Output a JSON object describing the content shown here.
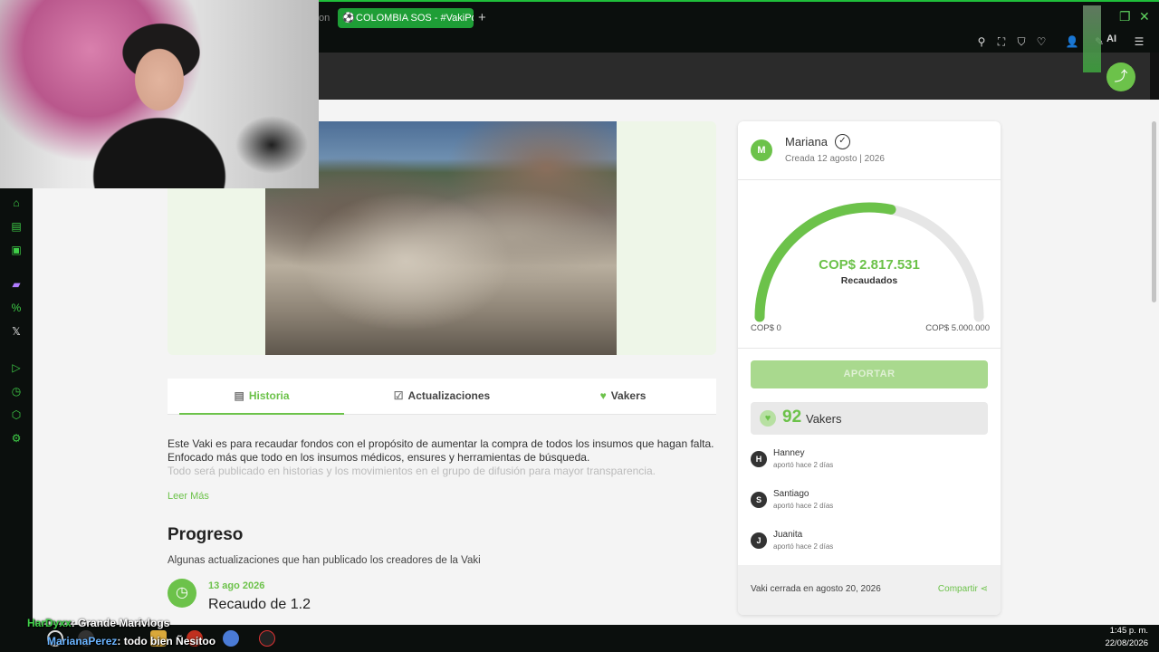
{
  "browser": {
    "prev_tab_fragment": "on",
    "active_tab_title": "COLOMBIA SOS - #VakiPor",
    "new_tab_symbol": "+",
    "ai_label": "AI"
  },
  "campaign": {
    "tabs": [
      {
        "label": "Historia"
      },
      {
        "label": "Actualizaciones"
      },
      {
        "label": "Vakers"
      }
    ],
    "story": [
      "Este Vaki es para recaudar fondos con el propósito de aumentar la compra de todos los insumos que hagan falta.",
      "Enfocado más que todo en los insumos médicos, ensures y herramientas de búsqueda.",
      "Todo será publicado en historias y los movimientos en el grupo de difusión para mayor transparencia."
    ],
    "read_more": "Leer Más",
    "progress_title": "Progreso",
    "progress_subtitle": "Algunas actualizaciones que han publicado los creadores de la Vaki",
    "update": {
      "date": "13 ago 2026",
      "title": "Recaudo de 1.2"
    }
  },
  "card": {
    "creator_initial": "M",
    "creator_name": "Mariana",
    "created_date": "Creada 12 agosto | 2026",
    "raised_amount": "COP$ 2.817.531",
    "raised_label": "Recaudados",
    "min_label": "COP$ 0",
    "max_label": "COP$ 5.000.000",
    "progress_fraction": 0.5635,
    "aportar_label": "APORTAR",
    "vakers_count": "92",
    "vakers_word": "Vakers",
    "donors": [
      {
        "initial": "H",
        "name": "Hanney",
        "time": "aportó hace 2 días"
      },
      {
        "initial": "S",
        "name": "Santiago",
        "time": "aportó hace 2 días"
      },
      {
        "initial": "J",
        "name": "Juanita",
        "time": "aportó hace 2 días"
      }
    ],
    "closed_text": "Vaki cerrada en agosto 20, 2026",
    "share_label": "Compartir"
  },
  "chat": [
    {
      "user": "HarDyxx",
      "message": ": Grande Marivlogs"
    },
    {
      "user": "MarianaPerez",
      "message": ": todo bien Ñesitoo"
    }
  ],
  "clock": {
    "time": "1:45 p. m.",
    "date": "22/08/2026"
  },
  "colors": {
    "accent_green": "#6cc24a",
    "browser_green": "#1fbf3a",
    "page_header": "#2b2b2b"
  }
}
